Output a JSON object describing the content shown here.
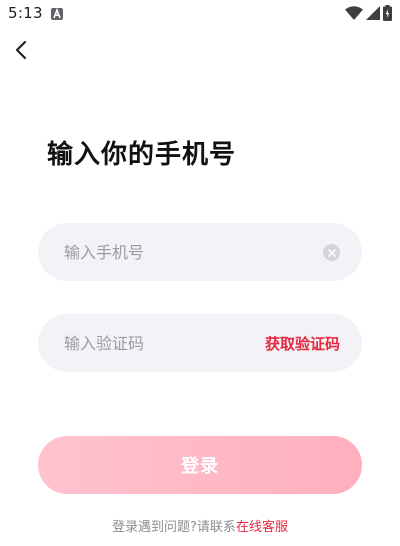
{
  "status_bar": {
    "time": "5:13",
    "notification_icon": "a-letter-icon",
    "wifi_icon": "wifi-icon",
    "signal_icon": "cell-signal-icon",
    "battery_icon": "battery-charging-icon"
  },
  "nav": {
    "back_icon": "chevron-left-icon"
  },
  "page": {
    "title": "输入你的手机号"
  },
  "phone_input": {
    "placeholder": "输入手机号",
    "value": "",
    "clear_icon": "clear-circle-icon"
  },
  "code_input": {
    "placeholder": "输入验证码",
    "value": "",
    "get_code_label": "获取验证码"
  },
  "login_button": {
    "label": "登录"
  },
  "help": {
    "prefix": "登录遇到问题?请联系",
    "link": "在线客服"
  },
  "colors": {
    "accent": "#e8283f",
    "input_bg": "#f3f2f7",
    "button_gradient_start": "#ffc3cf",
    "button_gradient_end": "#ffafbd"
  }
}
